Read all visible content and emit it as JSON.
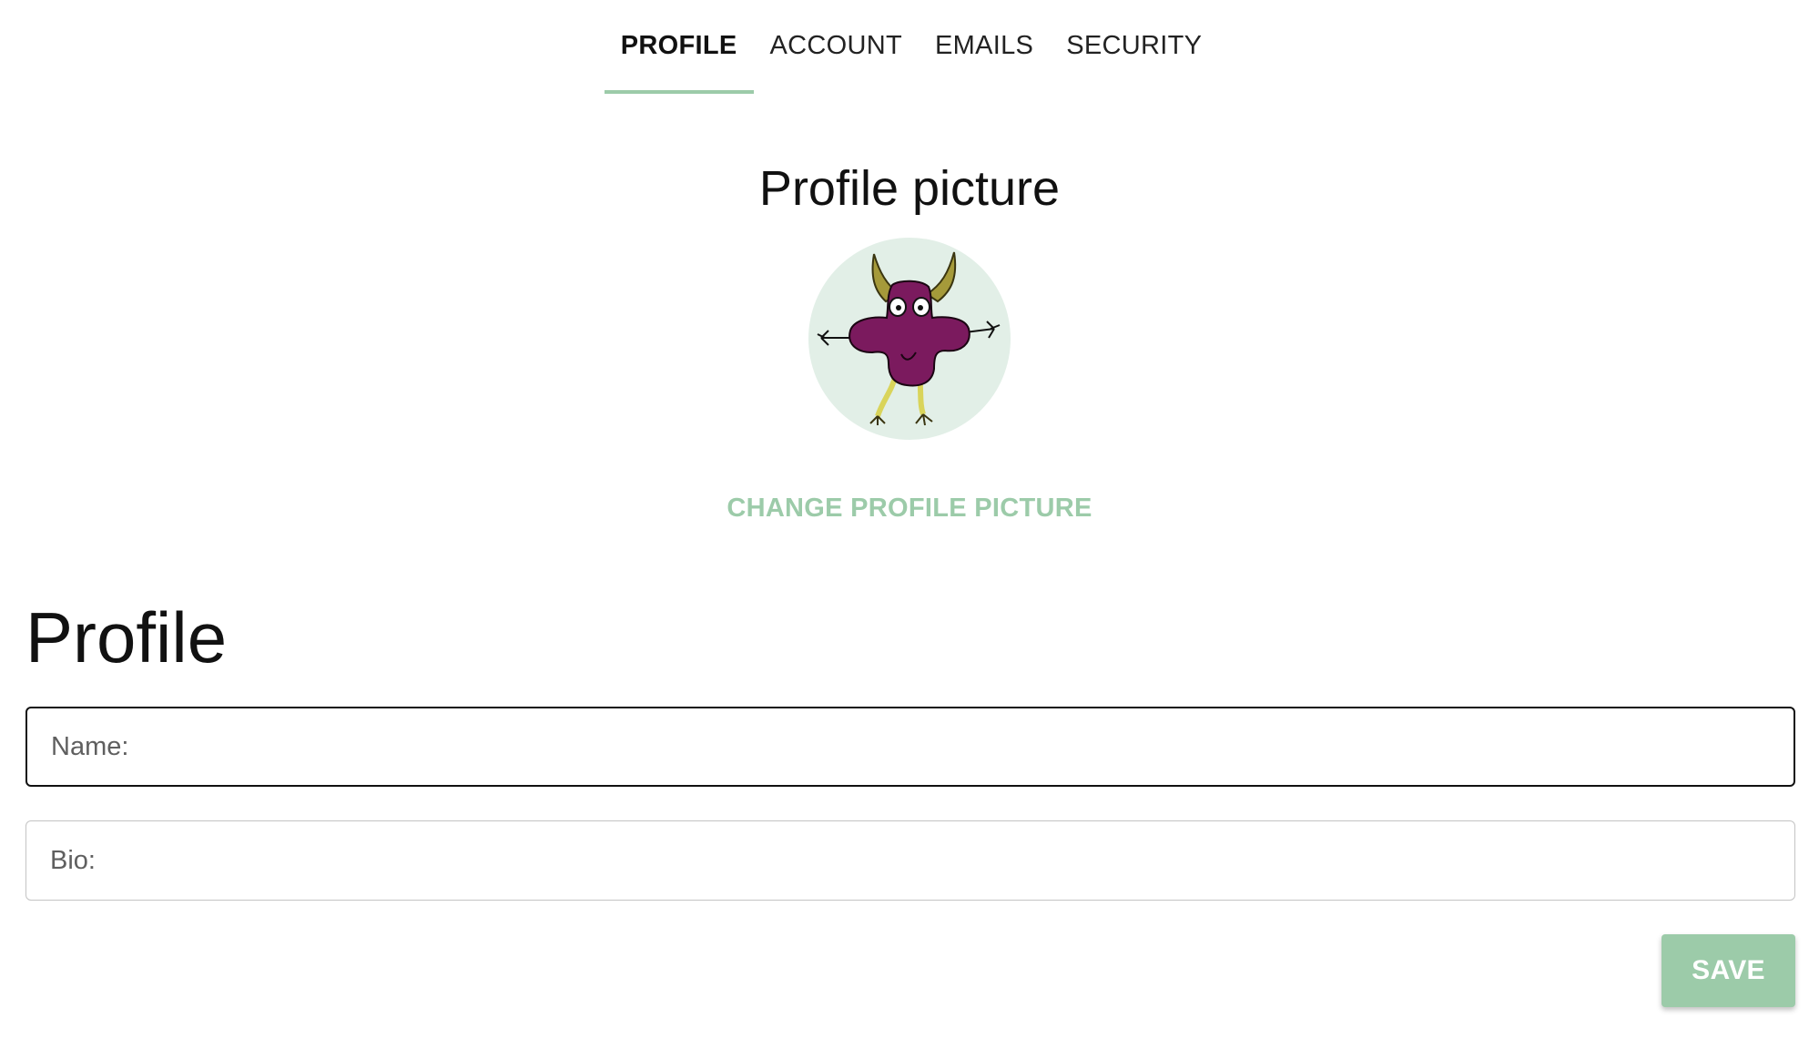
{
  "tabs": [
    {
      "label": "PROFILE",
      "active": true
    },
    {
      "label": "ACCOUNT",
      "active": false
    },
    {
      "label": "EMAILS",
      "active": false
    },
    {
      "label": "SECURITY",
      "active": false
    }
  ],
  "profile_picture": {
    "heading": "Profile picture",
    "avatar_icon": "horned-monster-avatar",
    "change_label": "CHANGE PROFILE PICTURE"
  },
  "profile": {
    "title": "Profile",
    "name_field": {
      "placeholder": "Name:",
      "value": ""
    },
    "bio_field": {
      "placeholder": "Bio:",
      "value": ""
    },
    "save_label": "SAVE"
  },
  "colors": {
    "accent": "#9ccba9",
    "avatar_bg": "#e2efe7",
    "monster_body": "#7b1a5e",
    "monster_horns": "#a59a3a",
    "monster_legs": "#d9d45a"
  }
}
